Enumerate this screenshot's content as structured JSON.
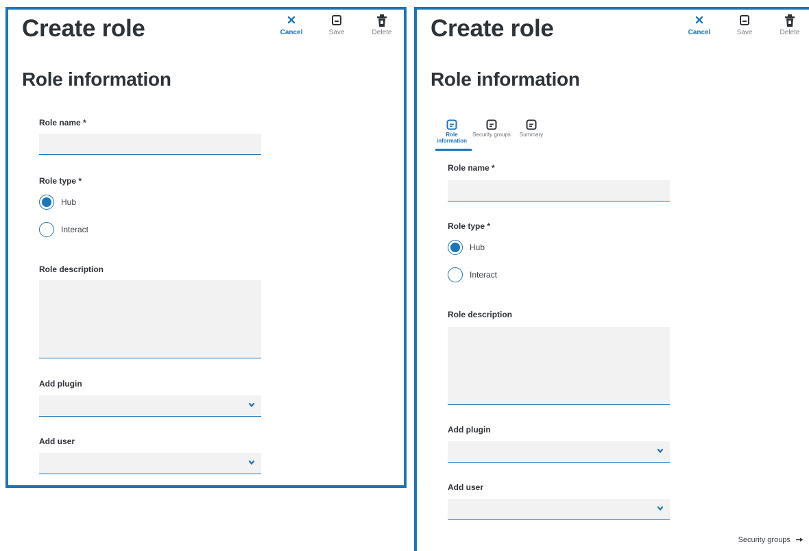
{
  "page": {
    "title": "Create role",
    "section": "Role information"
  },
  "toolbar": {
    "cancel_label": "Cancel",
    "save_label": "Save",
    "delete_label": "Delete"
  },
  "tabs": [
    {
      "label": "Role information",
      "icon": "document-icon",
      "active": true
    },
    {
      "label": "Security groups",
      "icon": "document-icon",
      "active": false
    },
    {
      "label": "Summary",
      "icon": "document-icon",
      "active": false
    }
  ],
  "form": {
    "role_name_label": "Role name *",
    "role_name_value": "",
    "role_type_label": "Role type *",
    "role_type_options": [
      "Hub",
      "Interact"
    ],
    "role_type_selected": "Hub",
    "role_description_label": "Role description",
    "role_description_value": "",
    "add_plugin_label": "Add plugin",
    "add_plugin_value": "",
    "add_user_label": "Add user",
    "add_user_value": ""
  },
  "navigation": {
    "next_label": "Security groups",
    "next_icon": "arrow-right-icon"
  },
  "colors": {
    "accent": "#1b75bb",
    "field_bg": "#f2f2f2",
    "heading": "#2e3338"
  }
}
